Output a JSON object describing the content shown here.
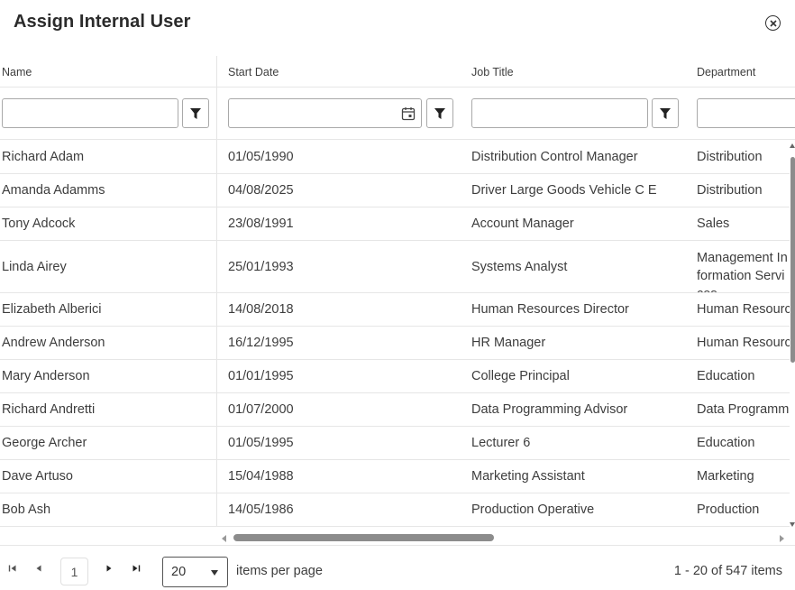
{
  "dialog": {
    "title": "Assign Internal User",
    "close_icon": "close-circle-icon"
  },
  "columns": [
    {
      "label": "Name"
    },
    {
      "label": "Start Date"
    },
    {
      "label": "Job Title"
    },
    {
      "label": "Department"
    }
  ],
  "filters": {
    "name_value": "",
    "start_date_value": "",
    "job_title_value": "",
    "department_value": "",
    "filter_icon": "filter-icon",
    "calendar_icon": "calendar-icon"
  },
  "rows": [
    {
      "name": "Richard Adam",
      "start_date": "01/05/1990",
      "job_title": "Distribution Control Manager",
      "department": "Distribution"
    },
    {
      "name": "Amanda Adamms",
      "start_date": "04/08/2025",
      "job_title": "Driver Large Goods Vehicle C E",
      "department": "Distribution"
    },
    {
      "name": "Tony Adcock",
      "start_date": "23/08/1991",
      "job_title": "Account Manager",
      "department": "Sales"
    },
    {
      "name": "Linda Airey",
      "start_date": "25/01/1993",
      "job_title": "Systems Analyst",
      "department": "Management Information Services"
    },
    {
      "name": "Elizabeth Alberici",
      "start_date": "14/08/2018",
      "job_title": "Human Resources Director",
      "department": "Human Resources"
    },
    {
      "name": "Andrew Anderson",
      "start_date": "16/12/1995",
      "job_title": "HR Manager",
      "department": "Human Resources"
    },
    {
      "name": "Mary Anderson",
      "start_date": "01/01/1995",
      "job_title": "College Principal",
      "department": "Education"
    },
    {
      "name": "Richard Andretti",
      "start_date": "01/07/2000",
      "job_title": "Data Programming Advisor",
      "department": "Data Programming"
    },
    {
      "name": "George Archer",
      "start_date": "01/05/1995",
      "job_title": "Lecturer 6",
      "department": "Education"
    },
    {
      "name": "Dave Artuso",
      "start_date": "15/04/1988",
      "job_title": "Marketing Assistant",
      "department": "Marketing"
    },
    {
      "name": "Bob Ash",
      "start_date": "14/05/1986",
      "job_title": "Production Operative",
      "department": "Production"
    }
  ],
  "pager": {
    "current_page": "1",
    "page_size": "20",
    "items_per_page_label": "items per page",
    "info": "1 - 20 of 547 items"
  }
}
